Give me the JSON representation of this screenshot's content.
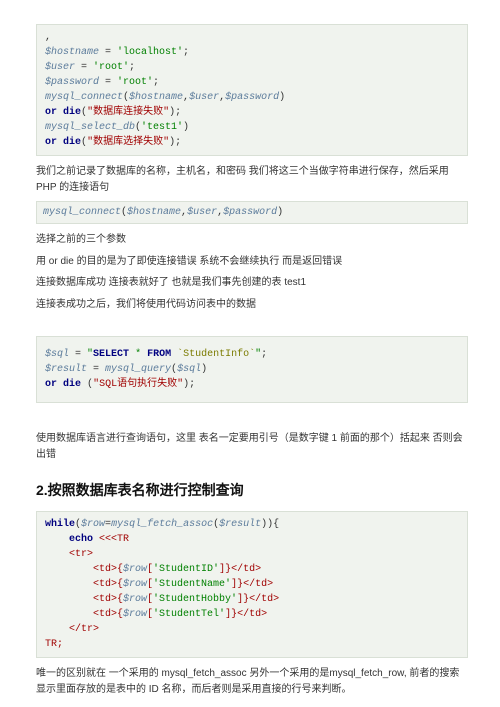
{
  "block1": {
    "l0": ",",
    "l1a": "$hostname",
    "l1b": " = ",
    "l1c": "'localhost'",
    "l1d": ";",
    "l2a": "$user",
    "l2b": " = ",
    "l2c": "'root'",
    "l2d": ";",
    "l3a": "$password",
    "l3b": " = ",
    "l3c": "'root'",
    "l3d": ";",
    "l4a": "mysql_connect",
    "l4b": "(",
    "l4c": "$hostname",
    "l4d": ",",
    "l4e": "$user",
    "l4f": ",",
    "l4g": "$password",
    "l4h": ")",
    "l5a": "or",
    "l5b": " ",
    "l5c": "die",
    "l5d": "(",
    "l5e": "\"数据库连接失败\"",
    "l5f": ");",
    "l6a": "mysql_select_db",
    "l6b": "(",
    "l6c": "'test1'",
    "l6d": ")",
    "l7a": "or",
    "l7b": " ",
    "l7c": "die",
    "l7d": "(",
    "l7e": "\"数据库选择失败\"",
    "l7f": ");"
  },
  "para1": "我们之前记录了数据库的名称，主机名，和密码  我们将这三个当做字符串进行保存，然后采用 PHP 的连接语句",
  "inline1": {
    "a": "mysql_connect",
    "b": "(",
    "c": "$hostname",
    "d": ",",
    "e": "$user",
    "f": ",",
    "g": "$password",
    "h": ")"
  },
  "para2": "选择之前的三个参数",
  "para3": "用 or die 的目的是为了即使连接错误   系统不会继续执行   而是返回错误",
  "para4": "连接数据库成功   连接表就好了   也就是我们事先创建的表 test1",
  "para5": "连接表成功之后，我们将使用代码访问表中的数据",
  "block2": {
    "l1a": "$sql",
    "l1b": " = ",
    "l1c": "\"",
    "l1d": "SELECT",
    "l1e": " * ",
    "l1f": "FROM",
    "l1g": " `StudentInfo`",
    "l1h": "\"",
    "l1i": ";",
    "l2a": "$result",
    "l2b": " = ",
    "l2c": "mysql_query",
    "l2d": "(",
    "l2e": "$sql",
    "l2f": ")",
    "l3a": "or",
    "l3b": " ",
    "l3c": "die",
    "l3d": " (",
    "l3e": "\"SQL语句执行失败\"",
    "l3f": ");"
  },
  "para6": "使用数据库语言进行查询语句，这里  表名一定要用引号（是数字键 1 前面的那个）括起来   否则会出错",
  "heading2": "2.按照数据库表名称进行控制查询",
  "block3": {
    "l1a": "while",
    "l1b": "(",
    "l1c": "$row",
    "l1d": "=",
    "l1e": "mysql_fetch_assoc",
    "l1f": "(",
    "l1g": "$result",
    "l1h": ")){",
    "l2a": "    ",
    "l2b": "echo",
    "l2c": " ",
    "l2d": "<<<TR",
    "l3": "    <tr>",
    "l4a": "        <td>{",
    "l4b": "$row",
    "l4c": "[",
    "l4d": "'StudentID'",
    "l4e": "]}</td>",
    "l5a": "        <td>{",
    "l5b": "$row",
    "l5c": "[",
    "l5d": "'StudentName'",
    "l5e": "]}</td>",
    "l6a": "        <td>{",
    "l6b": "$row",
    "l6c": "[",
    "l6d": "'StudentHobby'",
    "l6e": "]}</td>",
    "l7a": "        <td>{",
    "l7b": "$row",
    "l7c": "[",
    "l7d": "'StudentTel'",
    "l7e": "]}</td>",
    "l8": "    </tr>",
    "l9": "TR;"
  },
  "para7": "唯一的区别就在  一个采用的 mysql_fetch_assoc 另外一个采用的是mysql_fetch_row, 前者的搜索显示里面存放的是表中的 ID 名称，而后者则是采用直接的行号来判断。"
}
